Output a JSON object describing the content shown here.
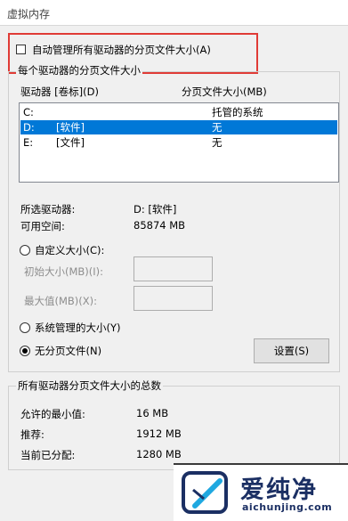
{
  "window": {
    "title": "虚拟内存"
  },
  "auto_manage": {
    "label": "自动管理所有驱动器的分页文件大小(A)",
    "checked": false
  },
  "per_drive": {
    "group_label": "每个驱动器的分页文件大小",
    "col_drive": "驱动器 [卷标](D)",
    "col_size": "分页文件大小(MB)",
    "rows": [
      {
        "drive": "C:",
        "label": "",
        "size": "托管的系统",
        "selected": false
      },
      {
        "drive": "D:",
        "label": "[软件]",
        "size": "无",
        "selected": true
      },
      {
        "drive": "E:",
        "label": "[文件]",
        "size": "无",
        "selected": false
      }
    ],
    "selected_drive_label": "所选驱动器:",
    "selected_drive_value": "D:  [软件]",
    "free_space_label": "可用空间:",
    "free_space_value": "85874 MB",
    "custom_size_label": "自定义大小(C):",
    "initial_size_label": "初始大小(MB)(I):",
    "initial_size_value": "",
    "max_size_label": "最大值(MB)(X):",
    "max_size_value": "",
    "system_managed_label": "系统管理的大小(Y)",
    "no_paging_label": "无分页文件(N)",
    "set_button": "设置(S)"
  },
  "totals": {
    "group_label": "所有驱动器分页文件大小的总数",
    "min_label": "允许的最小值:",
    "min_value": "16 MB",
    "recommended_label": "推荐:",
    "recommended_value": "1912 MB",
    "current_label": "当前已分配:",
    "current_value": "1280 MB"
  },
  "watermark": {
    "brand": "爱纯净",
    "url": "aichunjing.com"
  }
}
